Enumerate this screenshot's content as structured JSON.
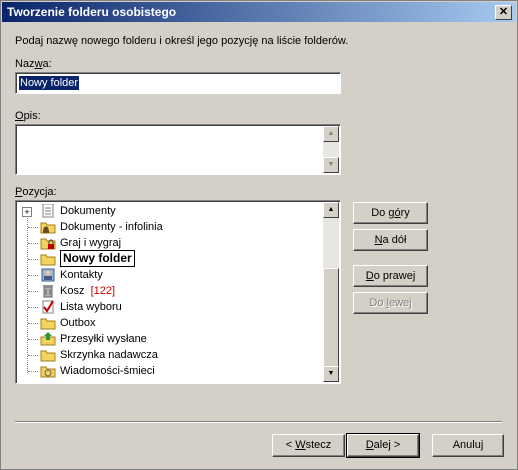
{
  "window": {
    "title": "Tworzenie folderu osobistego",
    "close_glyph": "✕"
  },
  "instruction": "Podaj nazwę nowego folderu i określ jego pozycję na liście folderów.",
  "name_field": {
    "label_pre": "Naz",
    "label_key": "w",
    "label_post": "a:",
    "value": "Nowy folder"
  },
  "desc_field": {
    "label_key": "O",
    "label_post": "pis:",
    "value": ""
  },
  "position": {
    "label_key": "P",
    "label_post": "ozycja:",
    "items": [
      {
        "label": "Dokumenty",
        "icon": "document-folder-icon",
        "expandable": true
      },
      {
        "label": "Dokumenty - infolinia",
        "icon": "shared-folder-icon"
      },
      {
        "label": "Graj i wygraj",
        "icon": "locked-folder-icon"
      },
      {
        "label": "Nowy folder",
        "icon": "folder-icon",
        "selected": true
      },
      {
        "label": "Kontakty",
        "icon": "contacts-icon"
      },
      {
        "label": "Kosz",
        "icon": "trash-icon",
        "count": "[122]"
      },
      {
        "label": "Lista wyboru",
        "icon": "checklist-icon"
      },
      {
        "label": "Outbox",
        "icon": "folder-icon"
      },
      {
        "label": "Przesyłki wysłane",
        "icon": "sent-folder-icon"
      },
      {
        "label": "Skrzynka nadawcza",
        "icon": "folder-icon"
      },
      {
        "label": "Wiadomości-śmieci",
        "icon": "junk-folder-icon"
      }
    ]
  },
  "buttons": {
    "up": {
      "pre": "Do g",
      "key": "ó",
      "post": "ry"
    },
    "down": {
      "pre": "",
      "key": "N",
      "post": "a dół"
    },
    "right": {
      "pre": "",
      "key": "D",
      "post": "o prawej"
    },
    "left": {
      "pre": "Do ",
      "key": "l",
      "post": "ewej"
    },
    "back": {
      "pre": "< ",
      "key": "W",
      "post": "stecz"
    },
    "next": {
      "pre": "",
      "key": "D",
      "post": "alej >"
    },
    "cancel": {
      "pre": "Anuluj",
      "key": "",
      "post": ""
    }
  },
  "colors": {
    "selection": "#0a246a",
    "count": "#c00000"
  }
}
